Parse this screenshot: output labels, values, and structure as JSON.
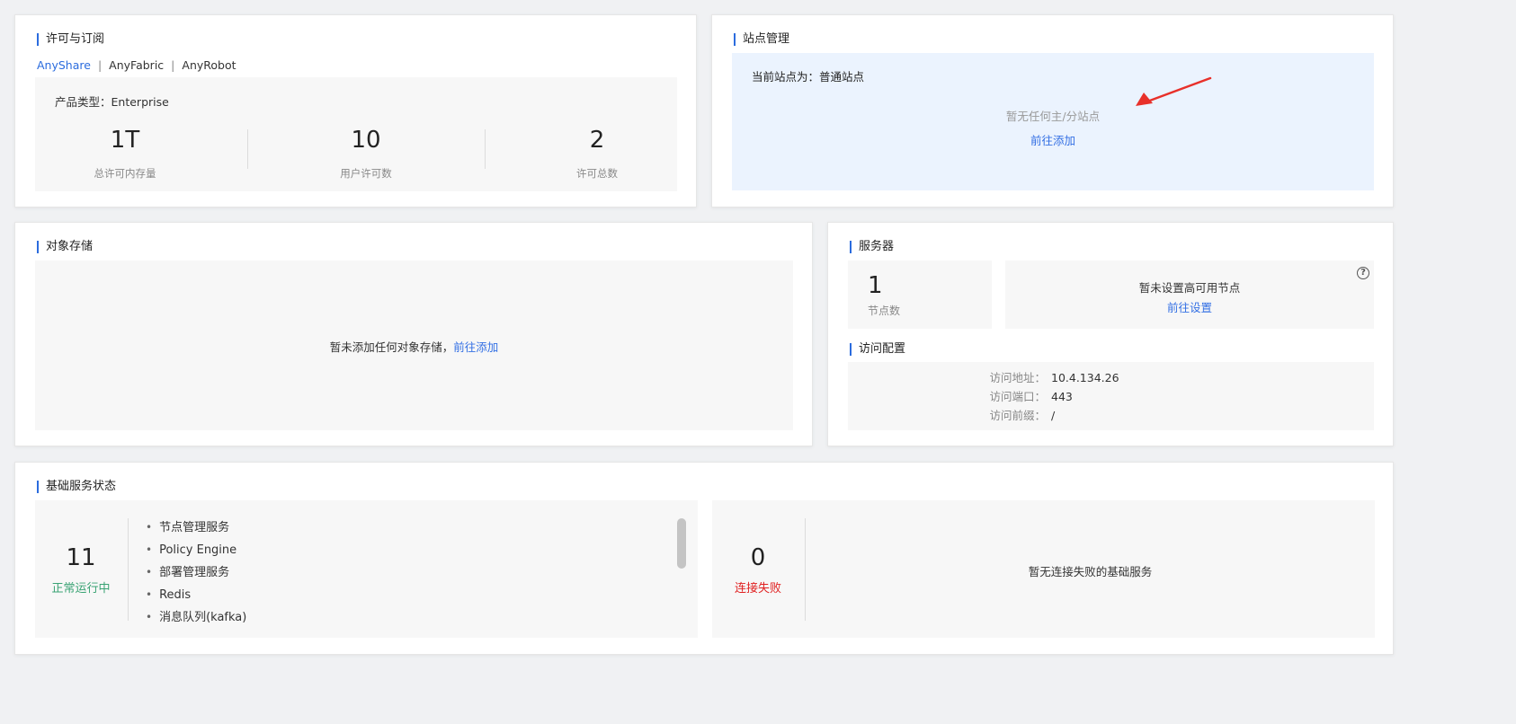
{
  "license": {
    "title": "许可与订阅",
    "tabs": [
      {
        "label": "AnyShare",
        "active": true
      },
      {
        "label": "AnyFabric",
        "active": false
      },
      {
        "label": "AnyRobot",
        "active": false
      }
    ],
    "tab_separator": "|",
    "product_type_label": "产品类型：",
    "product_type_value": "Enterprise",
    "stats": [
      {
        "value": "1T",
        "label": "总许可内存量"
      },
      {
        "value": "10",
        "label": "用户许可数"
      },
      {
        "value": "2",
        "label": "许可总数"
      }
    ]
  },
  "site": {
    "title": "站点管理",
    "current_label": "当前站点为：",
    "current_value": "普通站点",
    "empty_text": "暂无任何主/分站点",
    "add_link": "前往添加"
  },
  "object_storage": {
    "title": "对象存储",
    "empty_text": "暂未添加任何对象存储，",
    "add_link": "前往添加"
  },
  "server": {
    "title": "服务器",
    "node_count": "1",
    "node_label": "节点数",
    "ha_empty_text": "暂未设置高可用节点",
    "ha_link": "前往设置",
    "help_icon": "help-circle-icon"
  },
  "access": {
    "title": "访问配置",
    "rows": [
      {
        "key": "访问地址：",
        "value": "10.4.134.26"
      },
      {
        "key": "访问端口：",
        "value": "443"
      },
      {
        "key": "访问前缀：",
        "value": "/"
      }
    ]
  },
  "services": {
    "title": "基础服务状态",
    "running_count": "11",
    "running_label": "正常运行中",
    "running_color": "#3aa374",
    "running_items": [
      "节点管理服务",
      "Policy Engine",
      "部署管理服务",
      "Redis",
      "消息队列(kafka)"
    ],
    "failed_count": "0",
    "failed_label": "连接失败",
    "failed_color": "#e02020",
    "failed_empty_text": "暂无连接失败的基础服务"
  },
  "annotation": {
    "arrow_color": "#e8302a"
  },
  "colors": {
    "accent": "#2b6cde",
    "site_panel_bg": "#ebf3fe"
  }
}
